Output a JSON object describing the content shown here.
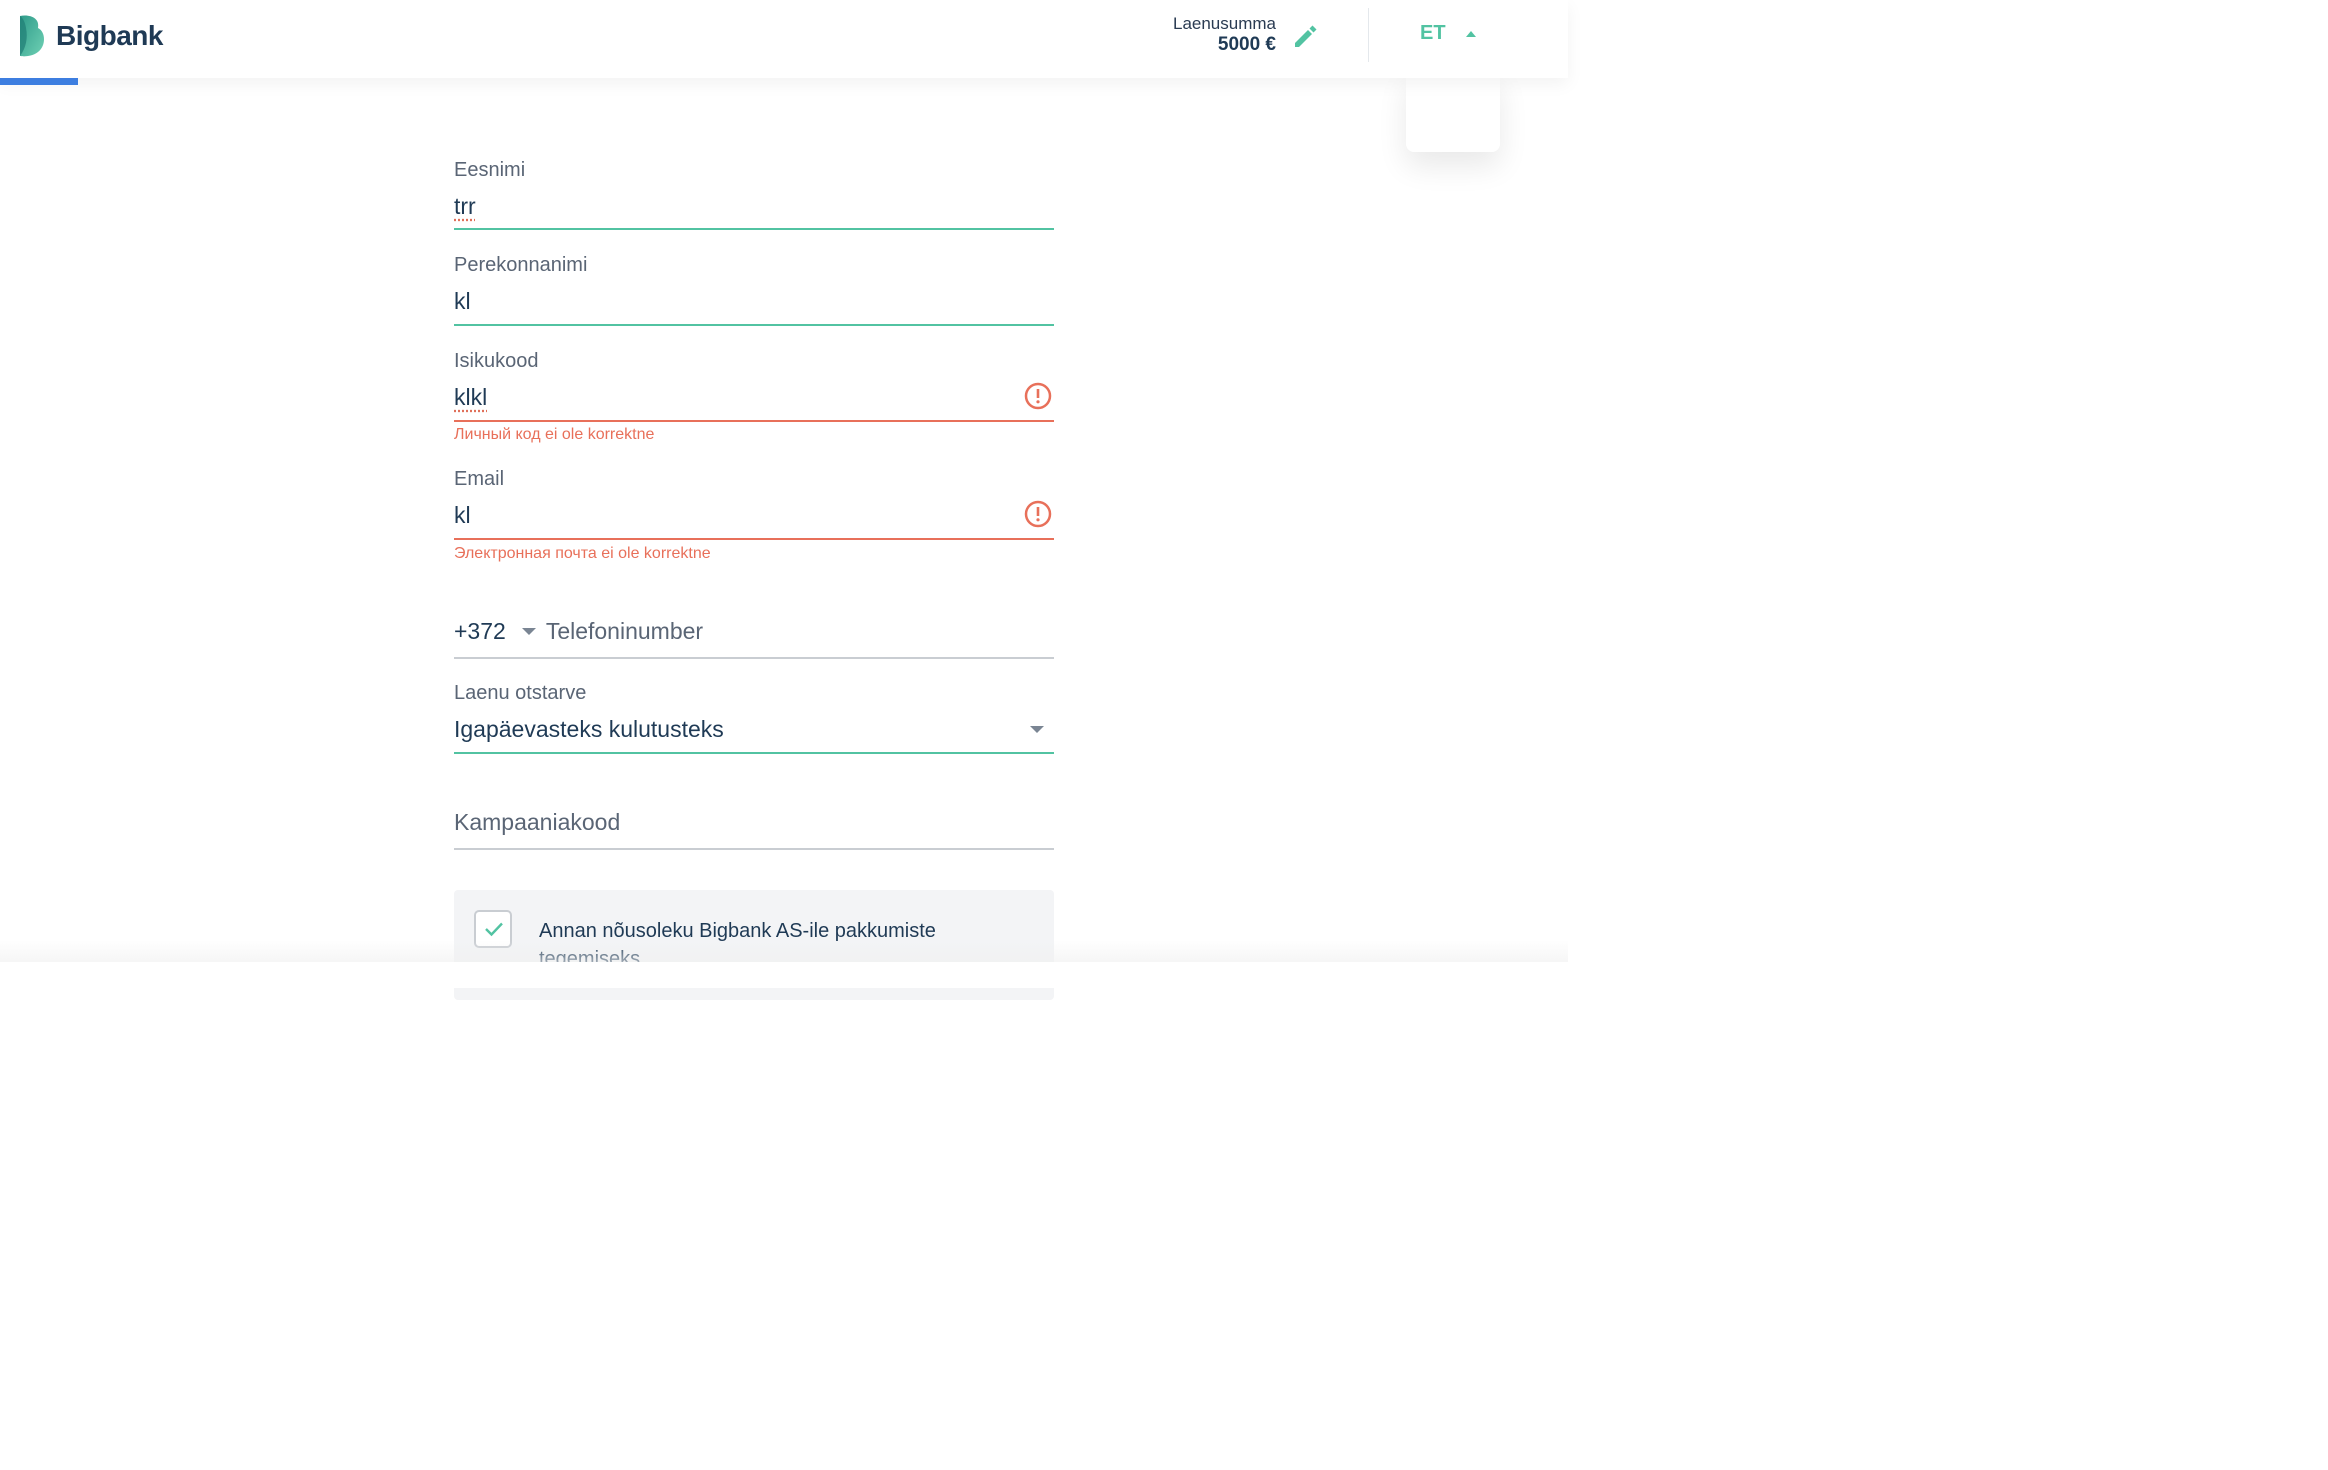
{
  "header": {
    "brand": "Bigbank",
    "loan_label": "Laenusumma",
    "loan_value": "5000 €",
    "language": "ET",
    "progress_fraction": 0.05
  },
  "form": {
    "first_name": {
      "label": "Eesnimi",
      "value": "trr"
    },
    "last_name": {
      "label": "Perekonnanimi",
      "value": "kl"
    },
    "personal_code": {
      "label": "Isikukood",
      "value": "klkl",
      "error": "Личный код ei ole korrektne"
    },
    "email": {
      "label": "Email",
      "value": "kl",
      "error": "Электронная почта ei ole korrektne"
    },
    "phone": {
      "code": "+372",
      "placeholder": "Telefoninumber"
    },
    "loan_purpose": {
      "label": "Laenu otstarve",
      "value": "Igapäevasteks kulutusteks"
    },
    "campaign_code": {
      "placeholder": "Kampaaniakood"
    },
    "consent": {
      "text": "Annan nõusoleku Bigbank AS-ile pakkumiste tegemiseks",
      "checked": true
    }
  },
  "colors": {
    "accent": "#52c3a2",
    "error": "#e8705a",
    "progress": "#3d7ee0",
    "text": "#1f3a55"
  }
}
